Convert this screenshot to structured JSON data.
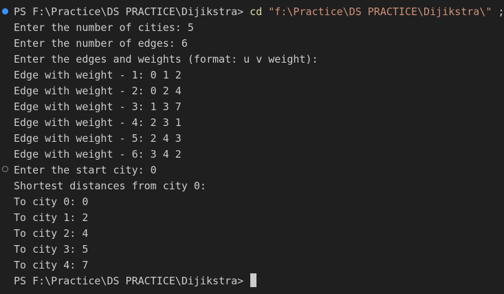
{
  "terminal": {
    "colors": {
      "background": "#1f1f1f",
      "text": "#cccccc",
      "command": "#dcdcaa",
      "string": "#ce9178",
      "success_marker": "#3794ff",
      "default_marker": "#8b8b8b",
      "cursor": "#cccccc"
    },
    "command_line": {
      "prompt": "PS F:\\Practice\\DS PRACTICE\\Dijikstra> ",
      "command": "cd",
      "argument": "\"f:\\Practice\\DS PRACTICE\\Dijikstra\\\"",
      "trailing": " ;"
    },
    "output_lines": [
      "Enter the number of cities: 5",
      "Enter the number of edges: 6",
      "Enter the edges and weights (format: u v weight):",
      "Edge with weight - 1: 0 1 2",
      "Edge with weight - 2: 0 2 4",
      "Edge with weight - 3: 1 3 7",
      "Edge with weight - 4: 2 3 1",
      "Edge with weight - 5: 2 4 3",
      "Edge with weight - 6: 3 4 2",
      "Enter the start city: 0",
      "Shortest distances from city 0:",
      "To city 0: 0",
      "To city 1: 2",
      "To city 2: 4",
      "To city 3: 5",
      "To city 4: 7"
    ],
    "final_prompt": "PS F:\\Practice\\DS PRACTICE\\Dijikstra>"
  }
}
